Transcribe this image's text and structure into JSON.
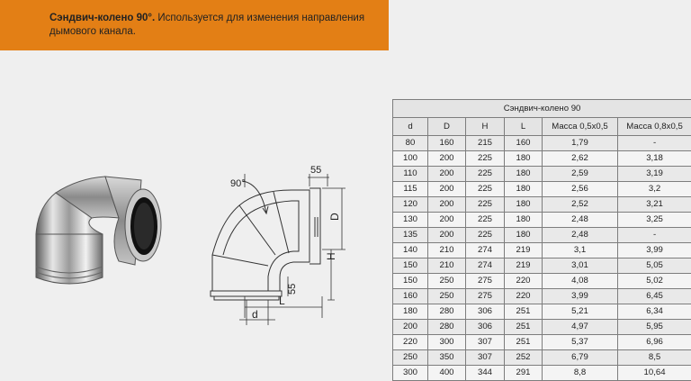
{
  "header": {
    "title": "Сэндвич-колено 90°.",
    "description": "Используется для изменения направления дымового канала."
  },
  "drawing": {
    "angle_label": "90°",
    "dim_top": "55",
    "dim_bottom": "55",
    "label_D": "D",
    "label_H": "H",
    "label_L": "L",
    "label_d": "d"
  },
  "table": {
    "title": "Сэндвич-колено 90",
    "columns": [
      "d",
      "D",
      "H",
      "L",
      "Масса 0,5х0,5",
      "Масса 0,8х0,5"
    ],
    "rows": [
      [
        "80",
        "160",
        "215",
        "160",
        "1,79",
        "-"
      ],
      [
        "100",
        "200",
        "225",
        "180",
        "2,62",
        "3,18"
      ],
      [
        "110",
        "200",
        "225",
        "180",
        "2,59",
        "3,19"
      ],
      [
        "115",
        "200",
        "225",
        "180",
        "2,56",
        "3,2"
      ],
      [
        "120",
        "200",
        "225",
        "180",
        "2,52",
        "3,21"
      ],
      [
        "130",
        "200",
        "225",
        "180",
        "2,48",
        "3,25"
      ],
      [
        "135",
        "200",
        "225",
        "180",
        "2,48",
        "-"
      ],
      [
        "140",
        "210",
        "274",
        "219",
        "3,1",
        "3,99"
      ],
      [
        "150",
        "210",
        "274",
        "219",
        "3,01",
        "5,05"
      ],
      [
        "150",
        "250",
        "275",
        "220",
        "4,08",
        "5,02"
      ],
      [
        "160",
        "250",
        "275",
        "220",
        "3,99",
        "6,45"
      ],
      [
        "180",
        "280",
        "306",
        "251",
        "5,21",
        "6,34"
      ],
      [
        "200",
        "280",
        "306",
        "251",
        "4,97",
        "5,95"
      ],
      [
        "220",
        "300",
        "307",
        "251",
        "5,37",
        "6,96"
      ],
      [
        "250",
        "350",
        "307",
        "252",
        "6,79",
        "8,5"
      ],
      [
        "300",
        "400",
        "344",
        "291",
        "8,8",
        "10,64"
      ]
    ]
  },
  "colors": {
    "banner": "#e37f15",
    "page_background": "#efefef",
    "table_border": "#7d7d7d"
  }
}
